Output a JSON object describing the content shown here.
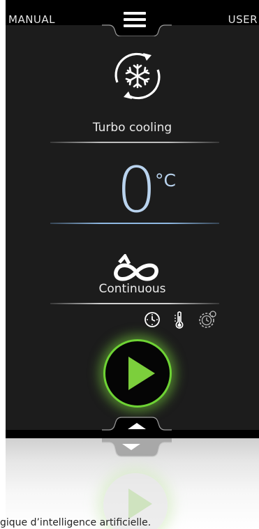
{
  "header": {
    "left_label": "MANUAL",
    "right_label": "USER",
    "menu_icon": "hamburger-menu-icon"
  },
  "mode": {
    "icon": "snowflake-cycle-icon",
    "label": "Turbo cooling"
  },
  "temperature": {
    "value": "0",
    "unit": "°C"
  },
  "duration": {
    "icon": "infinity-loop-icon",
    "label": "Continuous"
  },
  "options": [
    {
      "name": "clock-icon"
    },
    {
      "name": "thermometer-icon"
    },
    {
      "name": "timer-settings-icon"
    }
  ],
  "start_button": {
    "icon": "play-icon"
  },
  "footer": {
    "icon": "arrow-up-icon"
  },
  "caption": "gique d’intelligence artificielle.",
  "colors": {
    "accent_green": "#6ed334",
    "temperature_blue": "#b9d3ee",
    "panel": "#1c1c1c"
  }
}
